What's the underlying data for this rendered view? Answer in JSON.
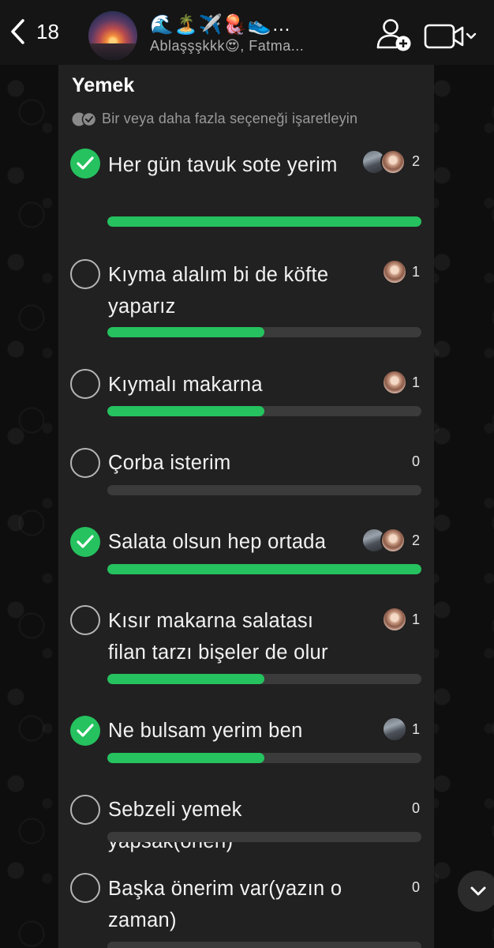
{
  "header": {
    "back_count": "18",
    "group_name": "🌊🏝️✈️🪼👟…",
    "members": "Ablaşşşkkk😍, Fatma..."
  },
  "poll": {
    "title": "Yemek",
    "subtitle": "Bir veya daha fazla seçeneği işaretleyin",
    "accent_color": "#25c25f",
    "options": [
      {
        "label": "Her gün tavuk sote yerim",
        "checked": true,
        "votes": "2",
        "fraction": 1.0
      },
      {
        "label": "Kıyma alalım bi de köfte yaparız",
        "checked": false,
        "votes": "1",
        "fraction": 0.5
      },
      {
        "label": "Kıymalı makarna",
        "checked": false,
        "votes": "1",
        "fraction": 0.5
      },
      {
        "label": "Çorba isterim",
        "checked": false,
        "votes": "0",
        "fraction": 0.0
      },
      {
        "label": "Salata olsun hep ortada",
        "checked": true,
        "votes": "2",
        "fraction": 1.0
      },
      {
        "label": "Kısır makarna salatası filan tarzı bişeler de olur",
        "checked": false,
        "votes": "1",
        "fraction": 0.5
      },
      {
        "label": "Ne bulsam yerim ben",
        "checked": true,
        "votes": "1",
        "fraction": 0.5
      },
      {
        "label": "Sebzeli yemek yapsak(öneri)",
        "checked": false,
        "votes": "0",
        "fraction": 0.0
      },
      {
        "label": "Başka önerim var(yazın o zaman)",
        "checked": false,
        "votes": "0",
        "fraction": 0.0
      }
    ]
  },
  "icons": {
    "back": "chevron-left-icon",
    "add_participant": "add-user-icon",
    "video_call": "video-camera-icon",
    "scroll_down": "chevron-down-icon"
  }
}
